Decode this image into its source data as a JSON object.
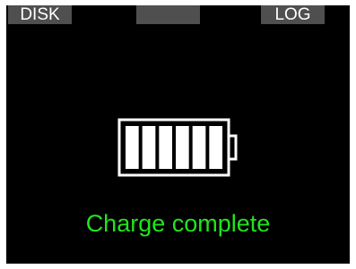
{
  "softkeys": {
    "left_label": "DISK",
    "middle_label": "",
    "right_label": "LOG"
  },
  "battery": {
    "icon": "battery-full-icon",
    "charge_level": 1.0,
    "segments_filled": 6,
    "segments_total": 6
  },
  "status": {
    "message": "Charge complete"
  },
  "colors": {
    "screen_background": "#000000",
    "softkey_background": "#4f4f4f",
    "softkey_text": "#ffffff",
    "status_text": "#22e41e",
    "battery_outline": "#ffffff"
  }
}
